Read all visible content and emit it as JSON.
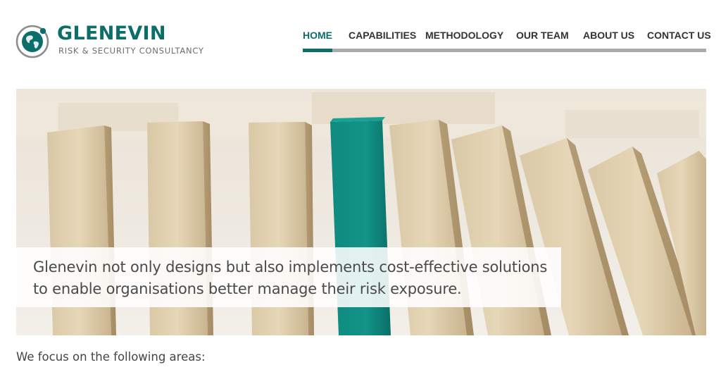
{
  "brand": {
    "name": "GLENEVIN",
    "tagline": "RISK & SECURITY CONSULTANCY",
    "logo_icon": "globe-icon",
    "accent_color": "#0b6e69"
  },
  "nav": {
    "items": [
      {
        "label": "HOME",
        "active": true
      },
      {
        "label": "CAPABILITIES",
        "active": false
      },
      {
        "label": "METHODOLOGY",
        "active": false
      },
      {
        "label": "OUR TEAM",
        "active": false
      },
      {
        "label": "ABOUT US",
        "active": false
      },
      {
        "label": "CONTACT US",
        "active": false
      }
    ]
  },
  "hero": {
    "image": "wooden-blocks-domino-teal-block",
    "caption": "Glenevin not only designs but also implements cost-effective solutions to enable organisations better manage their risk exposure."
  },
  "content": {
    "intro": "We focus on the following areas:"
  }
}
